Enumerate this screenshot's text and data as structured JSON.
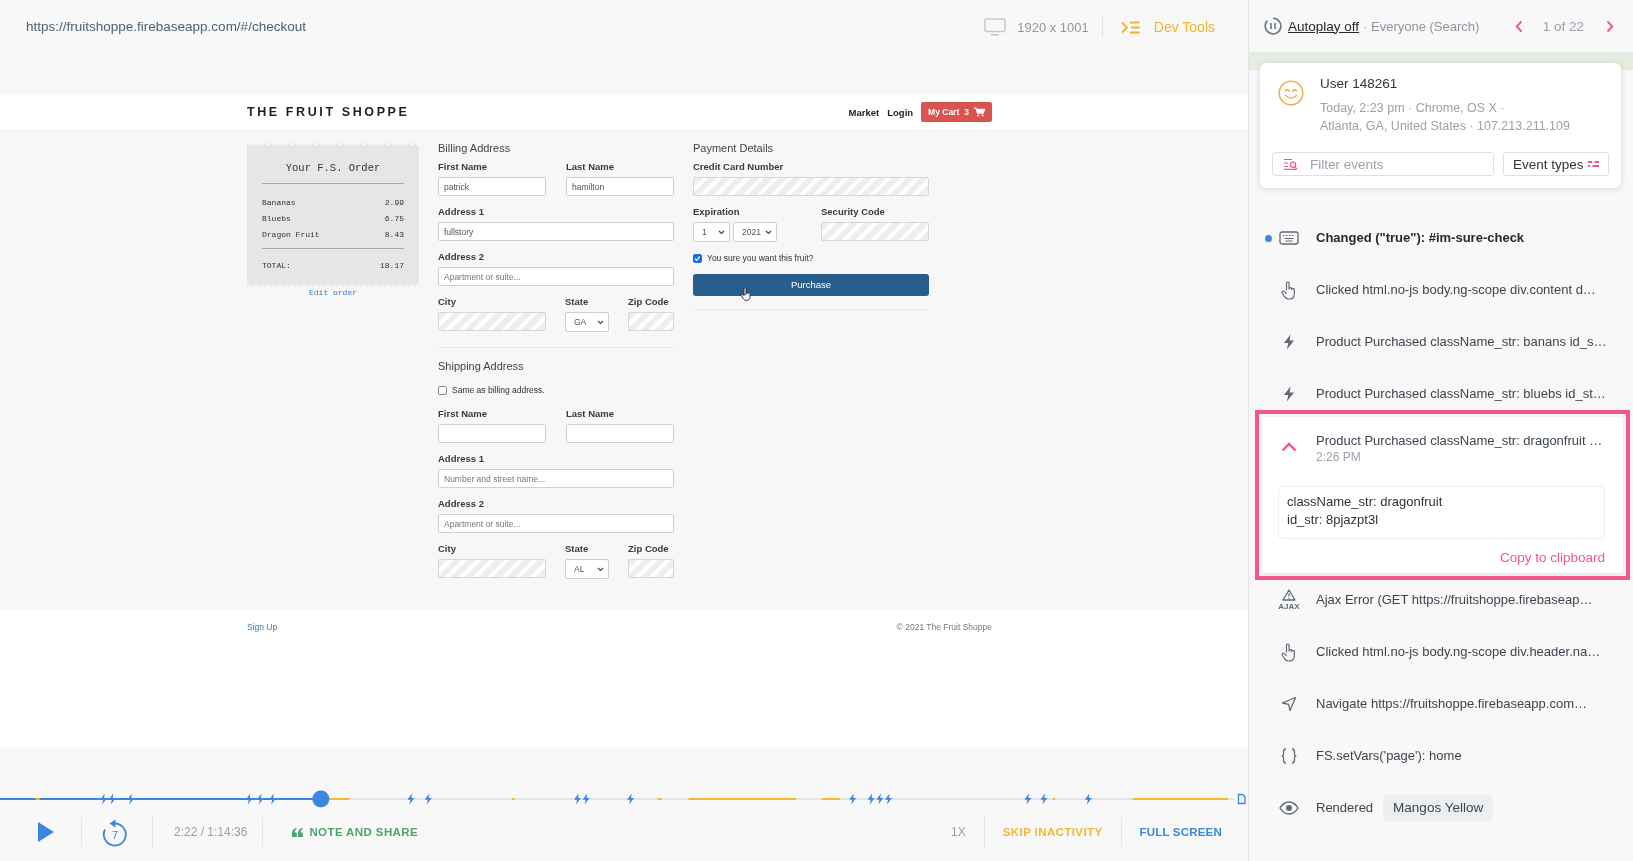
{
  "top_bar": {
    "url": "https://fruitshoppe.firebaseapp.com/#/checkout",
    "resolution": "1920 x 1001",
    "dev_tools": "Dev Tools"
  },
  "site": {
    "logo": "THE FRUIT SHOPPE",
    "nav": [
      "Market",
      "Login"
    ],
    "cart": {
      "label": "My Cart",
      "count": "3"
    },
    "receipt": {
      "title": "Your F.S. Order",
      "items": [
        {
          "name": "Bananas",
          "price": "2.99"
        },
        {
          "name": "Bluebs",
          "price": "6.75"
        },
        {
          "name": "Dragon Fruit",
          "price": "8.43"
        }
      ],
      "total_label": "TOTAL:",
      "total": "18.17",
      "edit_link": "Edit order"
    },
    "billing": {
      "heading": "Billing Address",
      "rows": [
        [
          {
            "label": "First Name",
            "kind": "text",
            "value": "patrick"
          },
          {
            "label": "Last Name",
            "kind": "text",
            "value": "hamilton"
          }
        ],
        [
          {
            "label": "Address 1",
            "kind": "text",
            "value": "fullstory"
          }
        ],
        [
          {
            "label": "Address 2",
            "kind": "text",
            "placeholder": "Apartment or suite..."
          }
        ],
        [
          {
            "label": "City",
            "kind": "masked"
          },
          {
            "label": "State",
            "kind": "select",
            "value": "GA"
          },
          {
            "label": "Zip Code",
            "kind": "masked"
          }
        ]
      ]
    },
    "shipping": {
      "heading": "Shipping Address",
      "same_as_billing": {
        "label": "Same as billing address.",
        "checked": false
      },
      "rows": [
        [
          {
            "label": "First Name",
            "kind": "text"
          },
          {
            "label": "Last Name",
            "kind": "text"
          }
        ],
        [
          {
            "label": "Address 1",
            "kind": "text",
            "placeholder": "Number and street name..."
          }
        ],
        [
          {
            "label": "Address 2",
            "kind": "text",
            "placeholder": "Apartment or suite..."
          }
        ],
        [
          {
            "label": "City",
            "kind": "masked"
          },
          {
            "label": "State",
            "kind": "select",
            "value": "AL"
          },
          {
            "label": "Zip Code",
            "kind": "masked"
          }
        ]
      ]
    },
    "payment": {
      "heading": "Payment Details",
      "rows": [
        [
          {
            "label": "Credit Card Number",
            "kind": "masked"
          }
        ],
        [
          {
            "label": "Expiration",
            "kind": "selects",
            "values": [
              "1",
              "2021"
            ]
          },
          {
            "label": "Security Code",
            "kind": "masked"
          }
        ]
      ],
      "confirm": {
        "label": "You sure you want this fruit?",
        "checked": true
      },
      "button": "Purchase"
    },
    "footer": {
      "link": "Sign Up",
      "copyright": "© 2021 The Fruit Shoppe"
    }
  },
  "player": {
    "timeline": {
      "level": 0.26
    },
    "rewind_label": "7",
    "time": "2:22 / 1:14:36",
    "note": "NOTE AND SHARE",
    "speed": "1X",
    "skip": "SKIP INACTIVITY",
    "fullscreen": "FULL SCREEN"
  },
  "sidebar": {
    "autoplay": "Autoplay off",
    "segment": "· Everyone (Search)",
    "pager": "1 of 22",
    "user": {
      "name": "User 148261",
      "meta": [
        "Today, 2:23 pm · Chrome, OS X ·",
        "Atlanta, GA, United States · 107.213.211.109"
      ]
    },
    "filter": {
      "placeholder": "Filter events"
    },
    "event_types": "Event types",
    "events": [
      {
        "kind": "keyboard",
        "text": "Changed (\"true\"): #im-sure-check",
        "current": true,
        "expanded": false
      },
      {
        "kind": "click",
        "text": "Clicked html.no-js body.ng-scope div.content d…",
        "current": false,
        "expanded": false
      },
      {
        "kind": "custom",
        "text": "Product Purchased className_str: banans id_s…",
        "current": false,
        "expanded": false
      },
      {
        "kind": "custom",
        "text": "Product Purchased className_str: bluebs id_st…",
        "current": false,
        "expanded": false
      },
      {
        "text": "Product Purchased className_str: dragonfruit …",
        "current": false,
        "expanded": true,
        "time": "2:26 PM",
        "details": [
          "className_str: dragonfruit",
          "id_str: 8pjazpt3l"
        ],
        "action": "Copy to clipboard"
      },
      {
        "kind": "ajax",
        "icon_label": "AJAX",
        "text": "Ajax Error (GET https://fruitshoppe.firebaseap…",
        "current": false,
        "expanded": false
      },
      {
        "kind": "click",
        "text": "Clicked html.no-js body.ng-scope div.header.na…",
        "current": false,
        "expanded": false
      },
      {
        "kind": "navigate",
        "text": "Navigate https://fruitshoppe.firebaseapp.com…",
        "current": false,
        "expanded": false
      },
      {
        "kind": "vars",
        "text": "FS.setVars('page'): home",
        "current": false,
        "expanded": false
      },
      {
        "kind": "render",
        "text": "Rendered",
        "tag": "Mangos Yellow",
        "current": false,
        "expanded": false
      }
    ]
  }
}
